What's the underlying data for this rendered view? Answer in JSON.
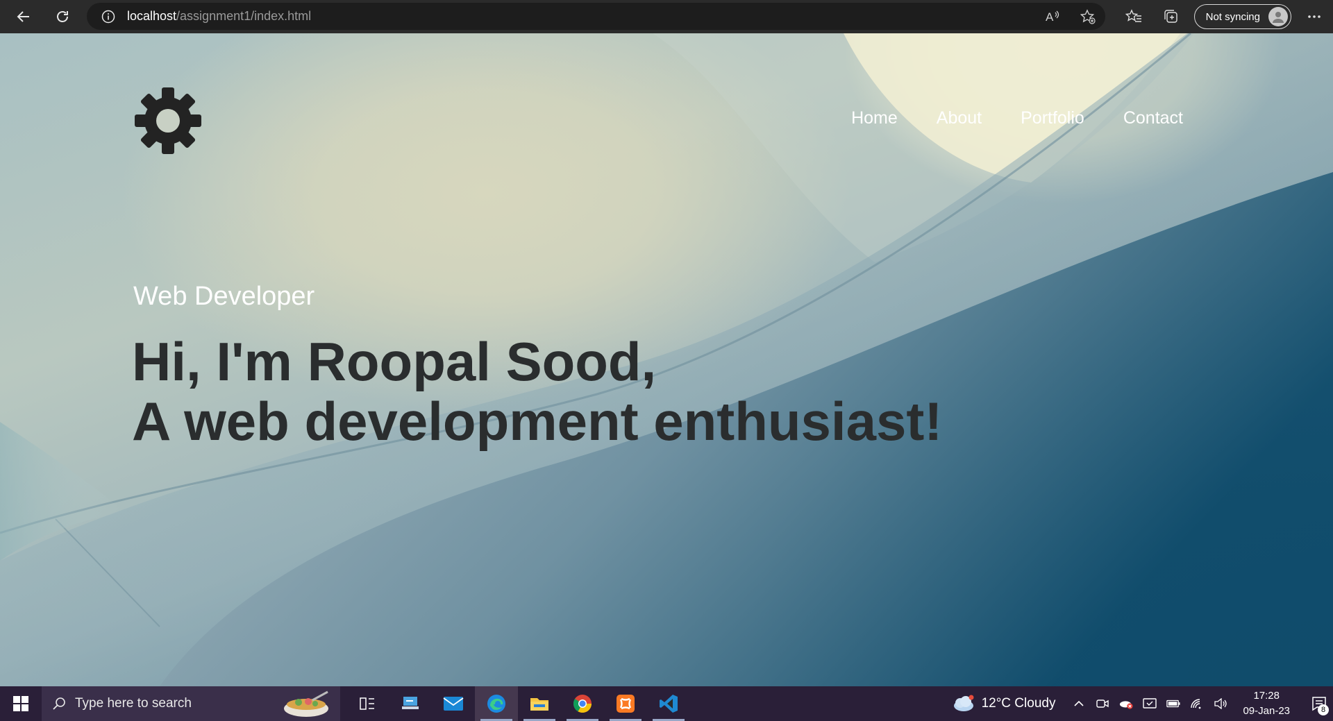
{
  "browser": {
    "url_host": "localhost",
    "url_path": "/assignment1/index.html",
    "sync_label": "Not syncing"
  },
  "page": {
    "nav": [
      "Home",
      "About",
      "Portfolio",
      "Contact"
    ],
    "subtitle": "Web Developer",
    "headline_line1": "Hi, I'm Roopal Sood,",
    "headline_line2": "A web development enthusiast!"
  },
  "taskbar": {
    "search_placeholder": "Type here to search",
    "weather": "12°C  Cloudy",
    "time": "17:28",
    "date": "09-Jan-23",
    "notification_count": "8",
    "apps": [
      "task-view",
      "remote-desktop",
      "mail",
      "edge",
      "file-explorer",
      "chrome",
      "xampp",
      "vscode"
    ]
  },
  "colors": {
    "chrome_bg": "#2b2b2b",
    "address_bg": "#1d1d1d",
    "headline": "#2a2d2e",
    "taskbar_bg": "#2a1f38"
  }
}
